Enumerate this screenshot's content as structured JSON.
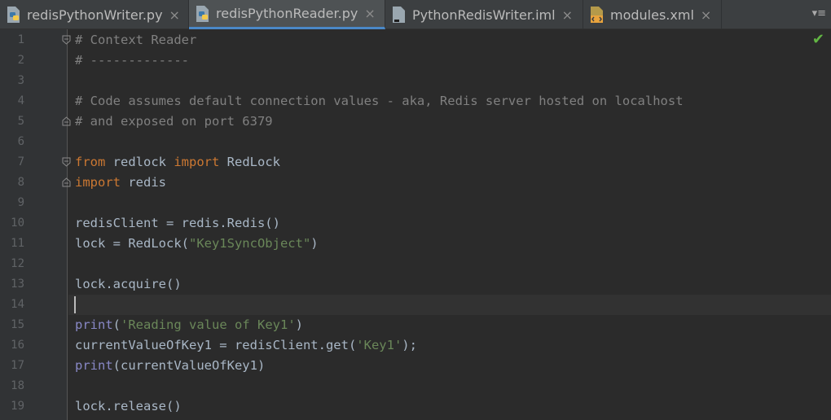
{
  "tabs": [
    {
      "label": "redisPythonWriter.py",
      "icon": "python-file-icon",
      "active": false
    },
    {
      "label": "redisPythonReader.py",
      "icon": "python-file-icon",
      "active": true
    },
    {
      "label": "PythonRedisWriter.iml",
      "icon": "module-file-icon",
      "active": false
    },
    {
      "label": "modules.xml",
      "icon": "xml-file-icon",
      "active": false
    }
  ],
  "tab_close_glyph": "×",
  "tab_menu_glyph": "▾≡",
  "line_numbers": [
    "1",
    "2",
    "3",
    "4",
    "5",
    "6",
    "7",
    "8",
    "9",
    "10",
    "11",
    "12",
    "13",
    "14",
    "15",
    "16",
    "17",
    "18",
    "19"
  ],
  "code": {
    "l1_comment": "# Context Reader",
    "l2_comment": "# -------------",
    "l4_comment": "# Code assumes default connection values - aka, Redis server hosted on localhost",
    "l5_comment": "# and exposed on port 6379",
    "l7_from": "from",
    "l7_mod": " redlock ",
    "l7_import": "import",
    "l7_name": " RedLock",
    "l8_import": "import",
    "l8_mod": " redis",
    "l10": "redisClient = redis.Redis()",
    "l11_pre": "lock = RedLock(",
    "l11_str": "\"Key1SyncObject\"",
    "l11_post": ")",
    "l13": "lock.acquire()",
    "l15_print": "print",
    "l15_open": "(",
    "l15_str": "'Reading value of Key1'",
    "l15_close": ")",
    "l16_pre": "currentValueOfKey1 = redisClient.get(",
    "l16_str": "'Key1'",
    "l16_post": ");",
    "l17_print": "print",
    "l17_rest": "(currentValueOfKey1)",
    "l19": "lock.release()"
  },
  "status": {
    "check_glyph": "✔"
  },
  "colors": {
    "background": "#2b2b2b",
    "comment": "#808080",
    "keyword": "#cc7832",
    "string": "#6a8759",
    "builtin": "#8888c6",
    "text": "#a9b7c6",
    "active_tab_underline": "#4a88c7",
    "ok_check": "#62b543"
  }
}
